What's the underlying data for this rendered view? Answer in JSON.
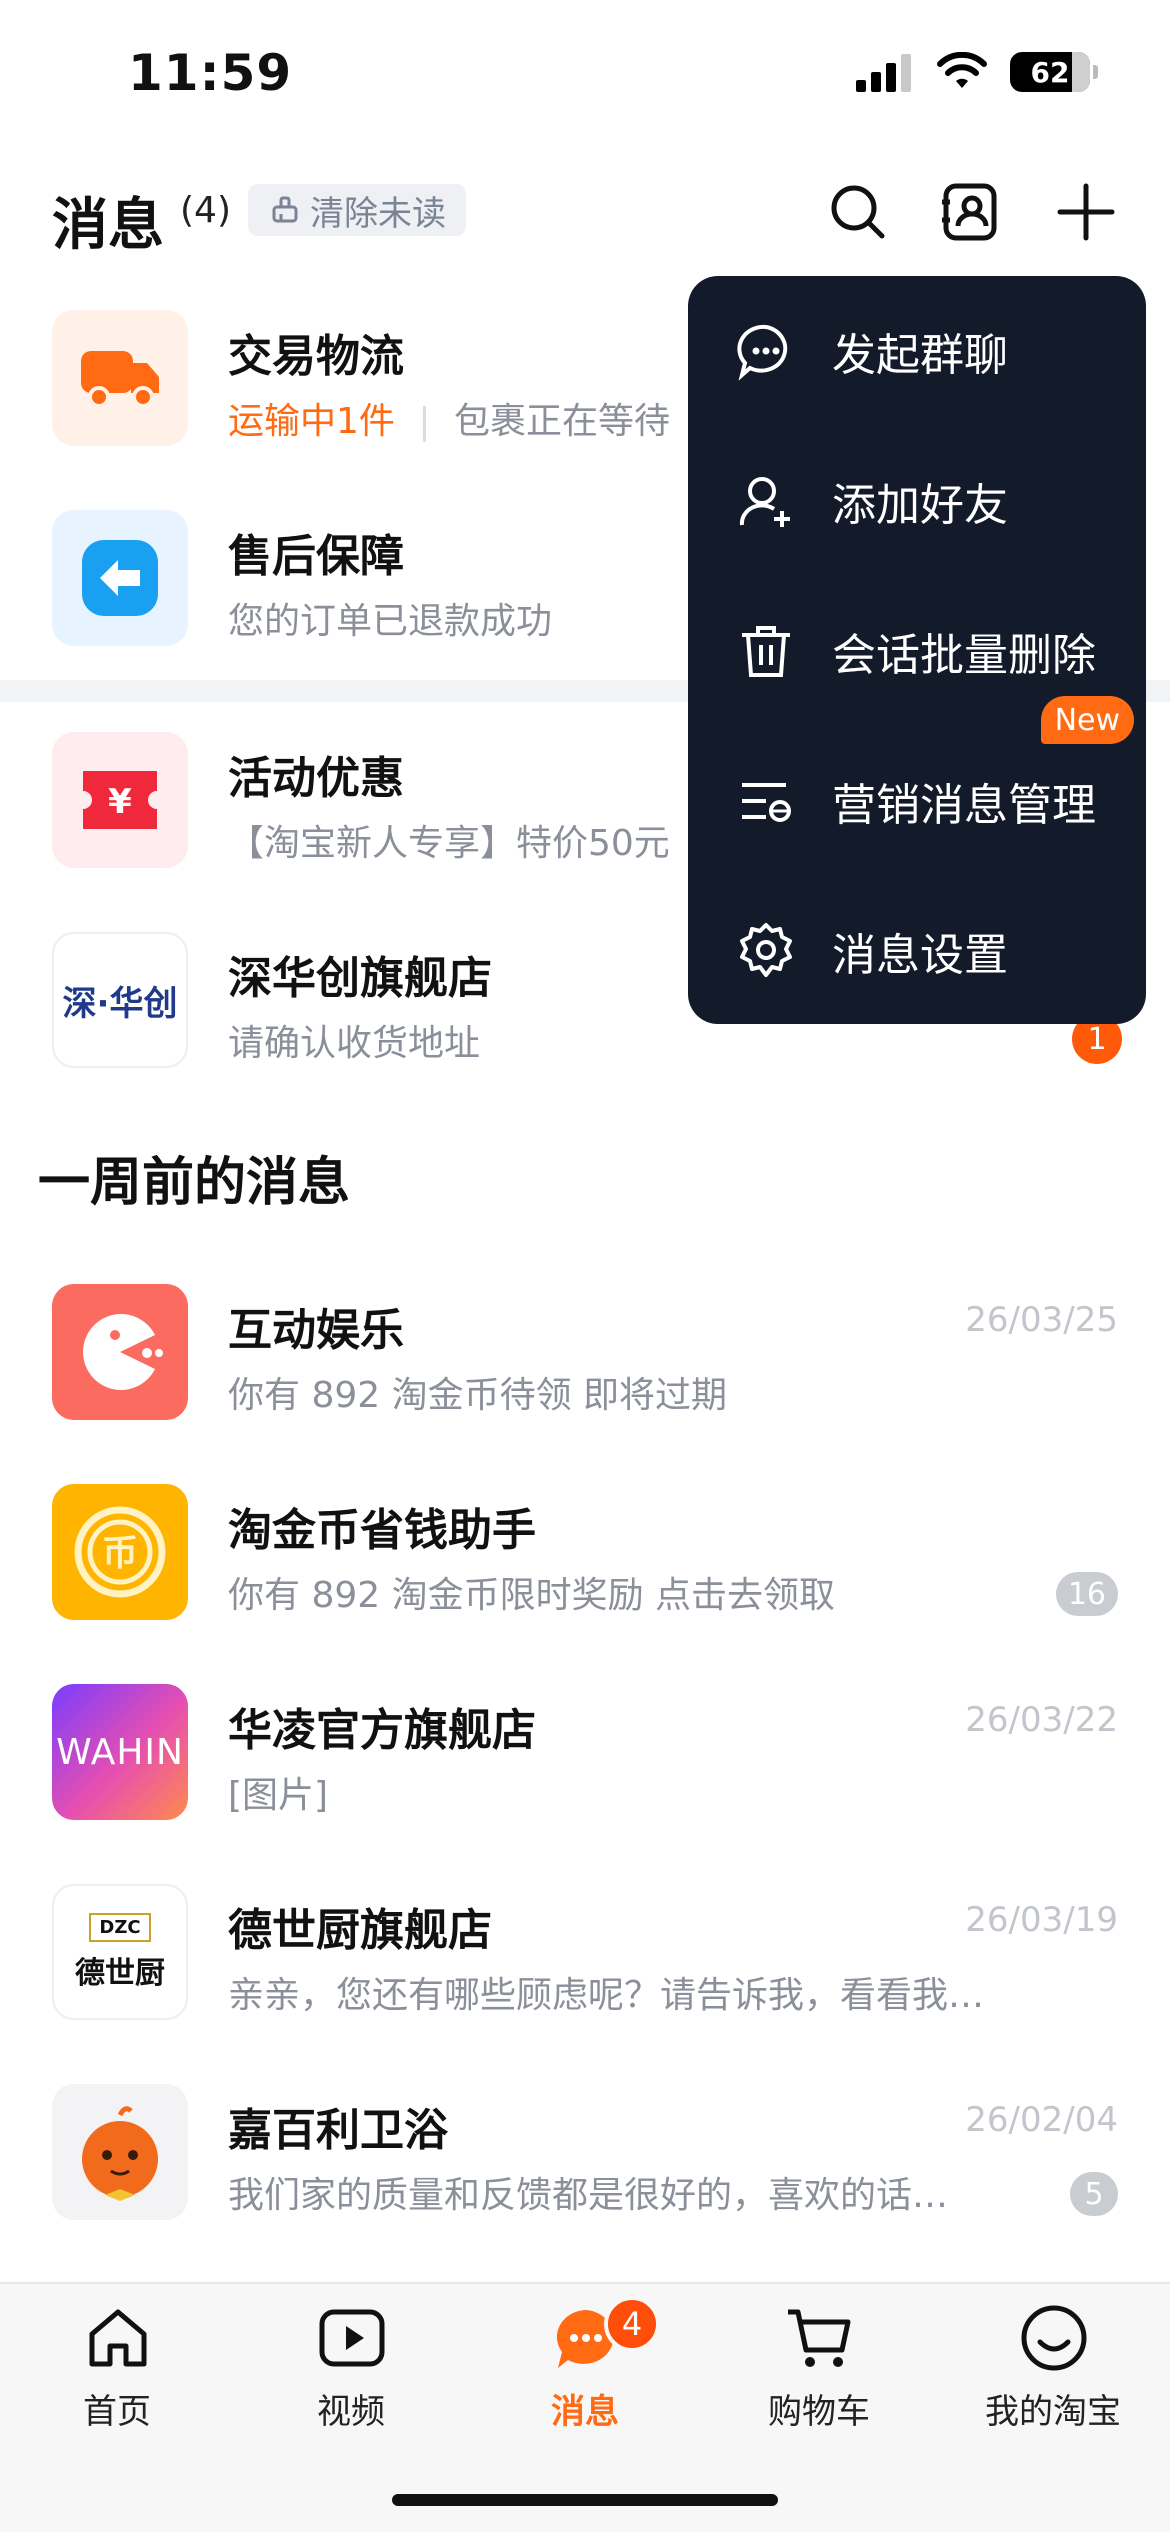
{
  "status_bar": {
    "time": "11:59",
    "battery": "62"
  },
  "header": {
    "title": "消息",
    "count": "(4)",
    "clear_unread": "清除未读"
  },
  "conversations": [
    {
      "title": "交易物流",
      "sub_highlight": "运输中1件",
      "sub": "包裹正在等待",
      "icon": "truck-icon",
      "color": "#ff6a13"
    },
    {
      "title": "售后保障",
      "sub": "您的订单已退款成功",
      "icon": "return-arrow-icon",
      "color": "#1aa0f0"
    },
    {
      "title": "活动优惠",
      "sub": "【淘宝新人专享】特价50元",
      "icon": "coupon-yen-icon",
      "color": "#f0283c"
    },
    {
      "title": "深华创旗舰店",
      "sub": "请确认收货地址",
      "logo_text": "深·华创",
      "badge": "1"
    }
  ],
  "section_week": "一周前的消息",
  "older": [
    {
      "title": "互动娱乐",
      "sub": "你有 892 淘金币待领  即将过期",
      "date": "26/03/25",
      "icon": "pacman-icon",
      "color": "#fb6b5f"
    },
    {
      "title": "淘金币省钱助手",
      "sub": "你有 892 淘金币限时奖励 点击去领取",
      "badge": "16",
      "icon": "gold-coin-icon",
      "color": "#ffb400"
    },
    {
      "title": "华凌官方旗舰店",
      "sub": "[图片]",
      "date": "26/03/22",
      "logo_text": "WAHIN"
    },
    {
      "title": "德世厨旗舰店",
      "sub": "亲亲，您还有哪些顾虑呢？请告诉我，看看我…",
      "date": "26/03/19",
      "logo_text": "德世厨",
      "logo_small": "DZC"
    },
    {
      "title": "嘉百利卫浴",
      "sub": "我们家的质量和反馈都是很好的，喜欢的话…",
      "date": "26/02/04",
      "badge": "5",
      "icon": "mascot-icon"
    }
  ],
  "menu": {
    "items": [
      {
        "label": "发起群聊",
        "icon": "chat-bubble-icon"
      },
      {
        "label": "添加好友",
        "icon": "add-user-icon"
      },
      {
        "label": "会话批量删除",
        "icon": "trash-icon"
      },
      {
        "label": "营销消息管理",
        "icon": "marketing-list-icon",
        "tag": "New"
      },
      {
        "label": "消息设置",
        "icon": "gear-icon"
      }
    ]
  },
  "tabbar": {
    "tabs": [
      {
        "label": "首页",
        "icon": "home-icon"
      },
      {
        "label": "视频",
        "icon": "video-play-icon"
      },
      {
        "label": "消息",
        "icon": "message-bubble-icon",
        "badge": "4",
        "active": true
      },
      {
        "label": "购物车",
        "icon": "cart-icon"
      },
      {
        "label": "我的淘宝",
        "icon": "smile-face-icon"
      }
    ]
  }
}
